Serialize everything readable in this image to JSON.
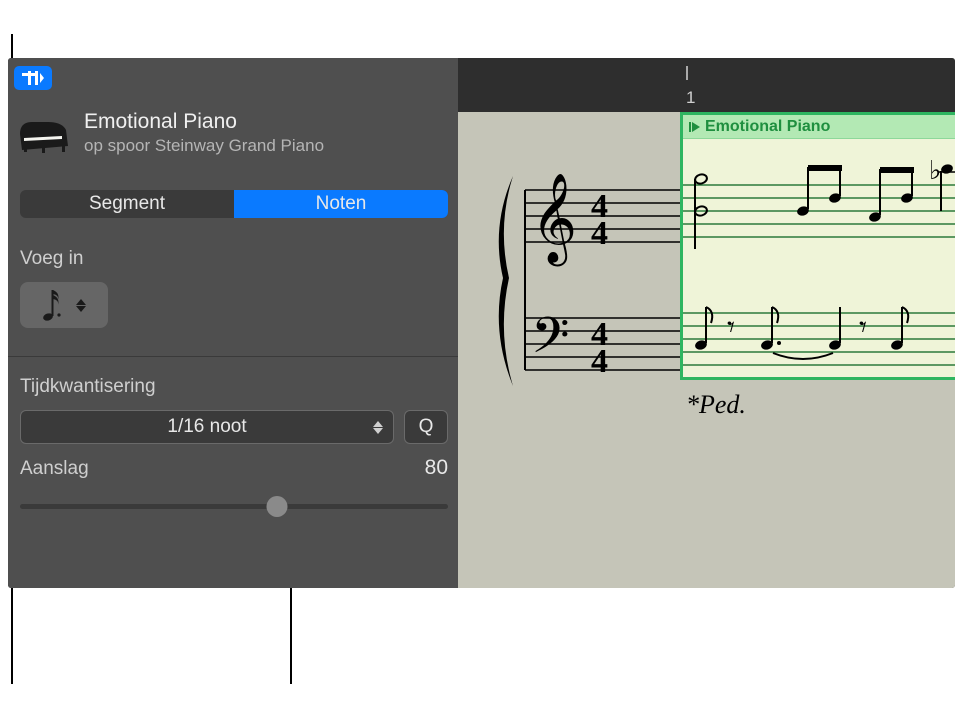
{
  "header": {
    "title": "Emotional Piano",
    "subtitle": "op spoor Steinway Grand Piano"
  },
  "tabs": {
    "segment": "Segment",
    "notes": "Noten"
  },
  "insert": {
    "label": "Voeg in",
    "selected_note_icon": "sixteenth-note"
  },
  "quantize": {
    "label": "Tijdkwantisering",
    "value": "1/16 noot",
    "q_button": "Q"
  },
  "velocity": {
    "label": "Aanslag",
    "value": "80",
    "slider_percent": 60
  },
  "ruler": {
    "bar_number": "1"
  },
  "region": {
    "name": "Emotional Piano"
  },
  "pedal_text": "*Ped."
}
